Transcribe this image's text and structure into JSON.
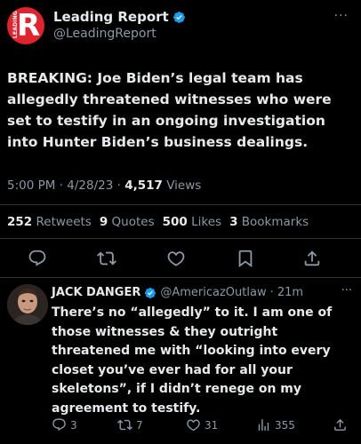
{
  "tweet": {
    "author": "Leading Report",
    "handle": "@LeadingReport",
    "more": "···",
    "logo_letter": "R",
    "logo_text": "LEADING",
    "text": "BREAKING: Joe Biden’s legal team has allegedly threatened witnesses who were set to testify in an ongoing investigation into Hunter Biden’s business dealings.",
    "time": "5:00 PM · 4/28/23 ·",
    "views_count": "4,517",
    "views_label": "Views",
    "stats": {
      "retweets": "252",
      "retweets_label": "Retweets",
      "quotes": "9",
      "quotes_label": "Quotes",
      "likes": "500",
      "likes_label": "Likes",
      "bookmarks": "3",
      "bookmarks_label": "Bookmarks"
    },
    "action_icons": [
      "reply-icon",
      "retweet-icon",
      "like-icon",
      "bookmark-icon",
      "share-icon"
    ]
  },
  "reply": {
    "author": "JACK DANGER",
    "handle": "@AmericazOutlaw",
    "time": "· 21m",
    "more": "···",
    "text": "There’s no “allegedly” to it. I am one of those witnesses & they outright threatened me with “looking into every closet you’ve ever had for all your skeletons”, if I didn’t renege on my agreement to testify.",
    "replies": "3",
    "retweets": "7",
    "likes": "31",
    "views": "355"
  },
  "colors": {
    "background": "#000000",
    "text": "#e7e9ea",
    "muted": "#8b98a5",
    "verified": "#1d9bf0",
    "logo": "#e0232d"
  }
}
